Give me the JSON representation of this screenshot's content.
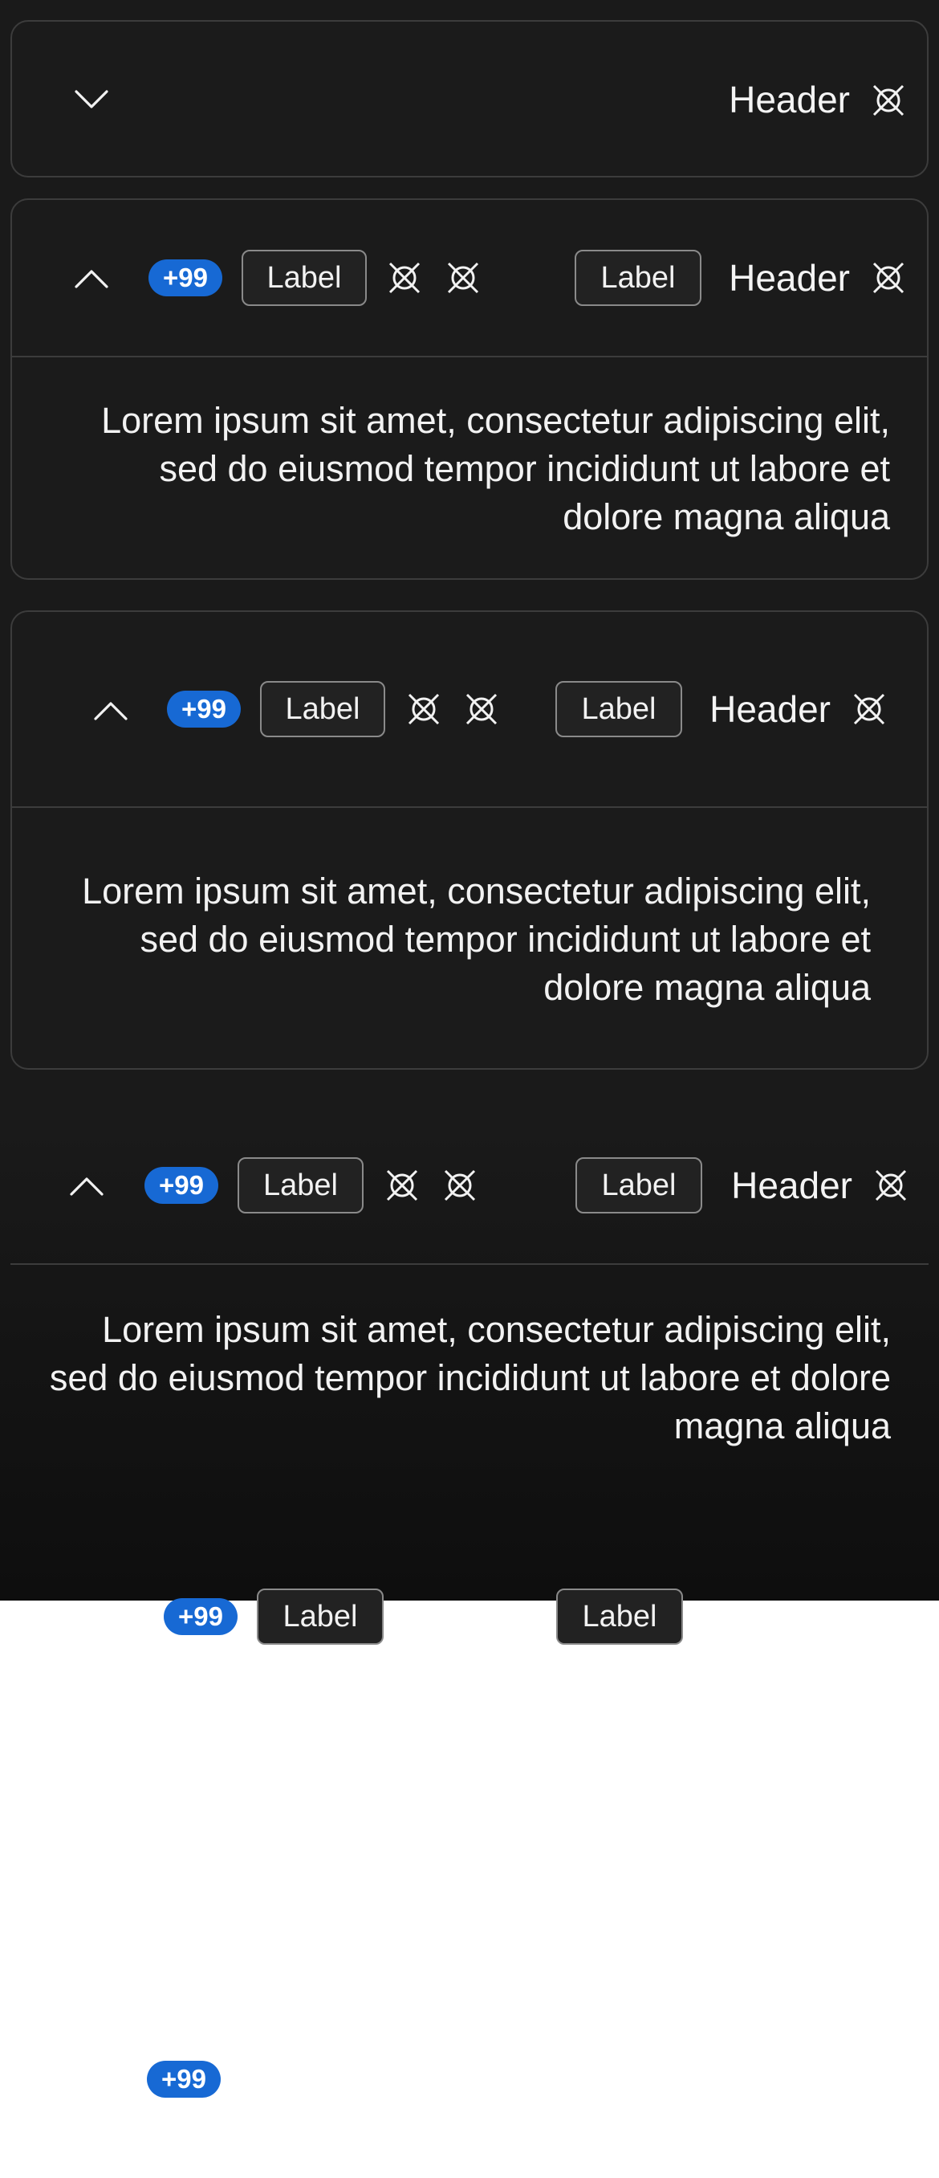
{
  "colors": {
    "background_dark": "#1a1a1a",
    "card_border": "#3c3c3c",
    "badge_blue": "#1769d4",
    "text": "#f2f2f2"
  },
  "accordion_1": {
    "header": "Header",
    "state": "collapsed",
    "toggle_icon": "chevron-down-icon",
    "trailing_icon": "crossed-box-icon"
  },
  "accordion_2": {
    "badge": "+99",
    "label_left": "Label",
    "label_right": "Label",
    "header": "Header",
    "state": "expanded",
    "toggle_icon": "chevron-up-icon",
    "body": "Lorem ipsum sit amet, consectetur adipiscing elit, sed do eiusmod tempor incididunt ut labore et dolore magna aliqua"
  },
  "accordion_3": {
    "badge": "+99",
    "label_left": "Label",
    "label_right": "Label",
    "header": "Header",
    "state": "expanded",
    "toggle_icon": "chevron-up-icon",
    "body": "Lorem ipsum sit amet, consectetur adipiscing elit, sed do eiusmod tempor incididunt ut labore et dolore magna aliqua"
  },
  "accordion_4": {
    "badge": "+99",
    "label_left": "Label",
    "label_right": "Label",
    "header": "Header",
    "state": "expanded",
    "toggle_icon": "chevron-up-icon",
    "body": "Lorem ipsum sit amet, consectetur adipiscing elit, sed do eiusmod tempor incididunt ut labore et dolore magna aliqua"
  },
  "overflow_row": {
    "badge": "+99",
    "label_left": "Label",
    "label_right": "Label"
  },
  "floating_badge": "+99"
}
